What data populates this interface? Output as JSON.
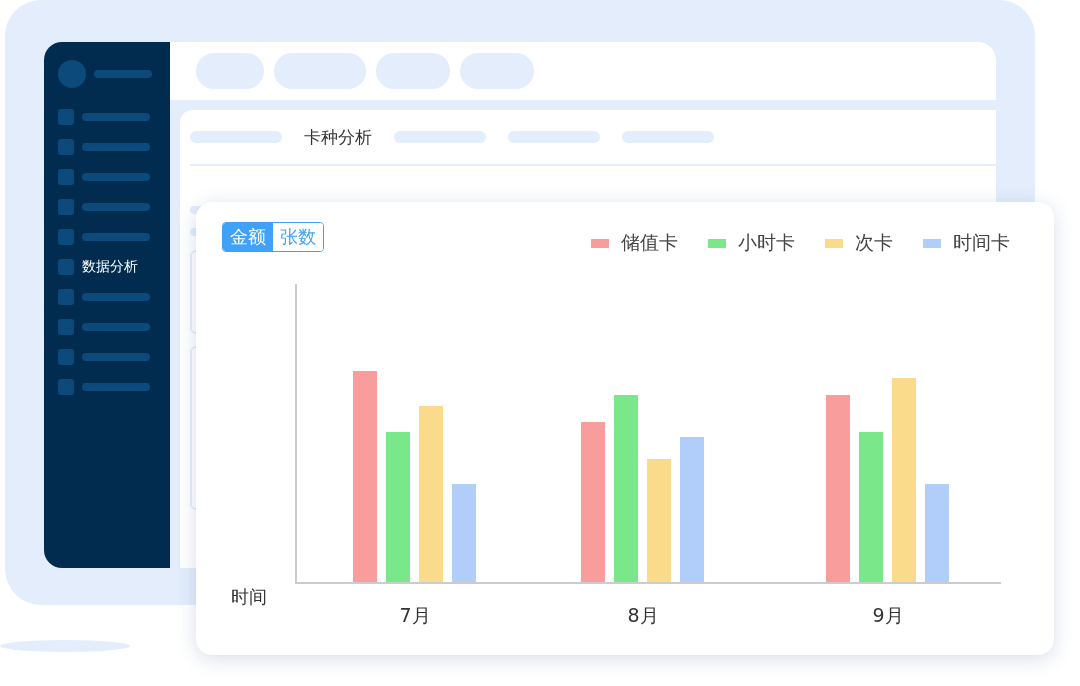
{
  "sidebar": {
    "label": "数据分析"
  },
  "panel": {
    "tab": "卡种分析"
  },
  "chart_card": {
    "toggle": [
      {
        "label": "金额",
        "selected": true
      },
      {
        "label": "张数",
        "selected": false
      }
    ],
    "legend": [
      {
        "label": "储值卡",
        "color": "#f99c9c"
      },
      {
        "label": "小时卡",
        "color": "#79e78a"
      },
      {
        "label": "次卡",
        "color": "#fadb8c"
      },
      {
        "label": "时间卡",
        "color": "#b1cdf9"
      }
    ],
    "axis_label": "时间",
    "categories": [
      "7月",
      "8月",
      "9月"
    ]
  }
}
